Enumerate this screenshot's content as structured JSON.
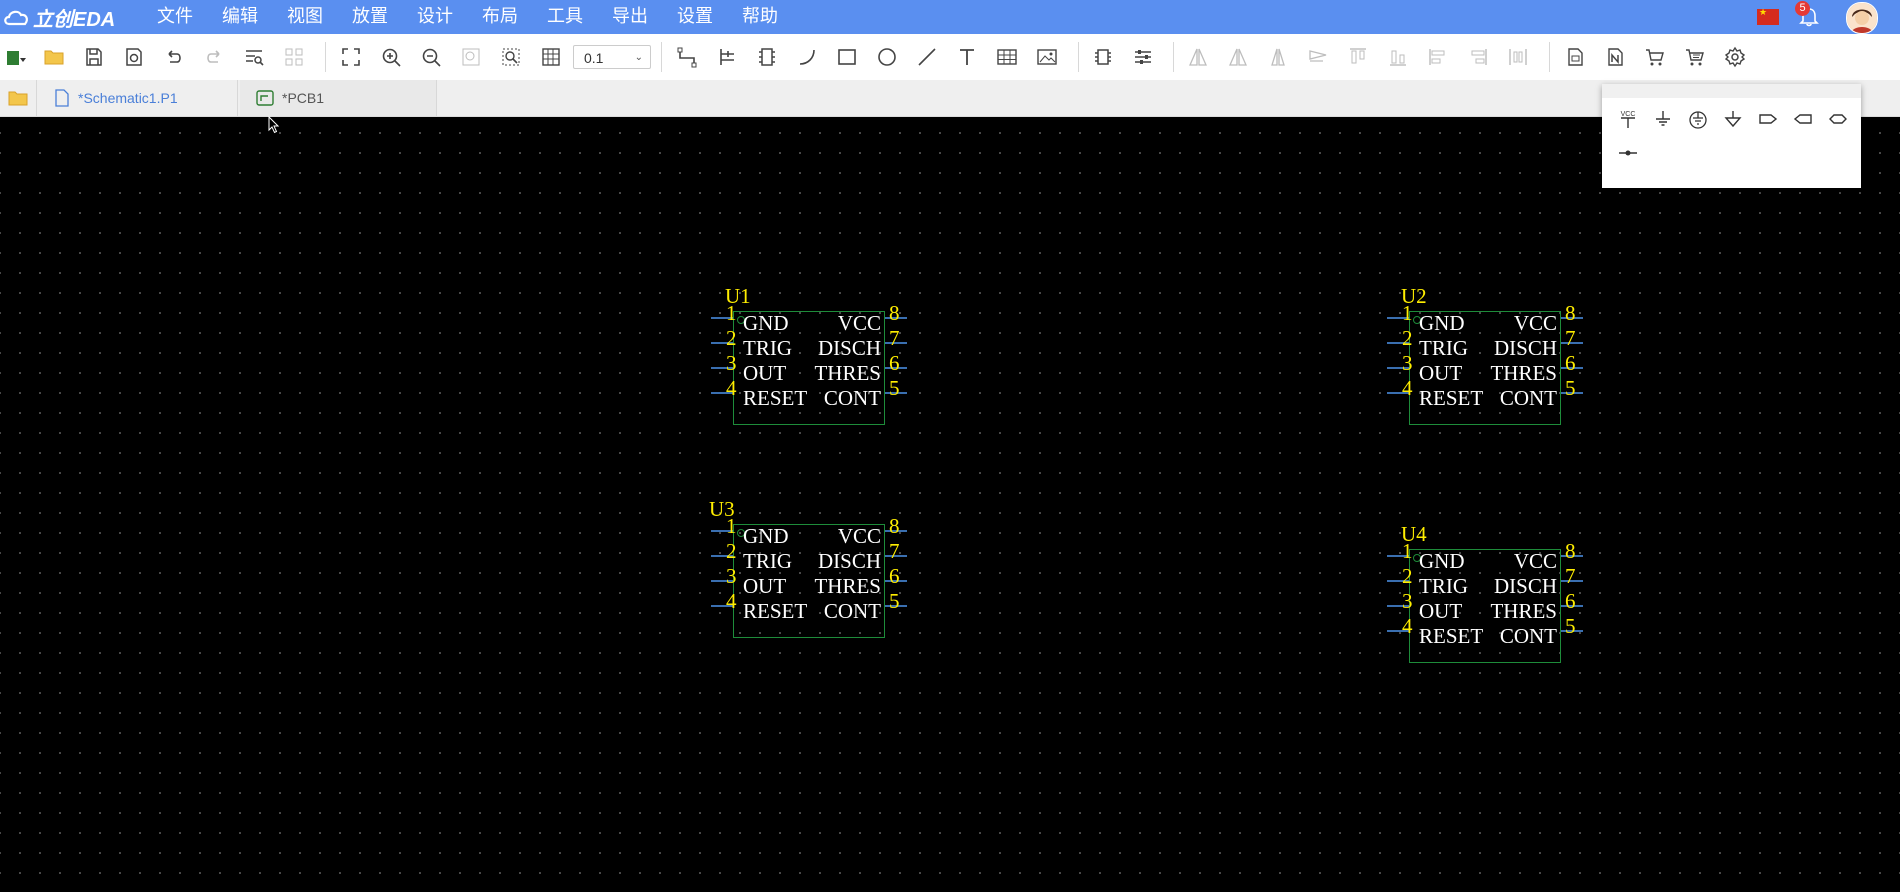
{
  "app": {
    "logo_text": "立创EDA"
  },
  "menu": [
    "文件",
    "编辑",
    "视图",
    "放置",
    "设计",
    "布局",
    "工具",
    "导出",
    "设置",
    "帮助"
  ],
  "notifications": {
    "count": "5"
  },
  "toolbar": {
    "zoom_value": "0.1"
  },
  "tabs": [
    {
      "label": "*Schematic1.P1",
      "icon": "schematic-page-icon",
      "active": true
    },
    {
      "label": "*PCB1",
      "icon": "pcb-icon",
      "active": false
    }
  ],
  "components": [
    {
      "designator": "U1",
      "pins_left": [
        {
          "num": "1",
          "name": "GND"
        },
        {
          "num": "2",
          "name": "TRIG"
        },
        {
          "num": "3",
          "name": "OUT"
        },
        {
          "num": "4",
          "name": "RESET"
        }
      ],
      "pins_right": [
        {
          "num": "8",
          "name": "VCC"
        },
        {
          "num": "7",
          "name": "DISCH"
        },
        {
          "num": "6",
          "name": "THRES"
        },
        {
          "num": "5",
          "name": "CONT"
        }
      ]
    },
    {
      "designator": "U2",
      "pins_left": [
        {
          "num": "1",
          "name": "GND"
        },
        {
          "num": "2",
          "name": "TRIG"
        },
        {
          "num": "3",
          "name": "OUT"
        },
        {
          "num": "4",
          "name": "RESET"
        }
      ],
      "pins_right": [
        {
          "num": "8",
          "name": "VCC"
        },
        {
          "num": "7",
          "name": "DISCH"
        },
        {
          "num": "6",
          "name": "THRES"
        },
        {
          "num": "5",
          "name": "CONT"
        }
      ]
    },
    {
      "designator": "U3",
      "pins_left": [
        {
          "num": "1",
          "name": "GND"
        },
        {
          "num": "2",
          "name": "TRIG"
        },
        {
          "num": "3",
          "name": "OUT"
        },
        {
          "num": "4",
          "name": "RESET"
        }
      ],
      "pins_right": [
        {
          "num": "8",
          "name": "VCC"
        },
        {
          "num": "7",
          "name": "DISCH"
        },
        {
          "num": "6",
          "name": "THRES"
        },
        {
          "num": "5",
          "name": "CONT"
        }
      ]
    },
    {
      "designator": "U4",
      "pins_left": [
        {
          "num": "1",
          "name": "GND"
        },
        {
          "num": "2",
          "name": "TRIG"
        },
        {
          "num": "3",
          "name": "OUT"
        },
        {
          "num": "4",
          "name": "RESET"
        }
      ],
      "pins_right": [
        {
          "num": "8",
          "name": "VCC"
        },
        {
          "num": "7",
          "name": "DISCH"
        },
        {
          "num": "6",
          "name": "THRES"
        },
        {
          "num": "5",
          "name": "CONT"
        }
      ]
    }
  ],
  "net_flag_panel": {
    "vcc_label": "VCC"
  },
  "colors": {
    "menubar": "#5a8ff0",
    "designator": "#ffee00",
    "body_outline": "#1e8c3a",
    "pin_name": "#ffffff",
    "pin_line": "#3a6fb0",
    "canvas": "#000000"
  }
}
